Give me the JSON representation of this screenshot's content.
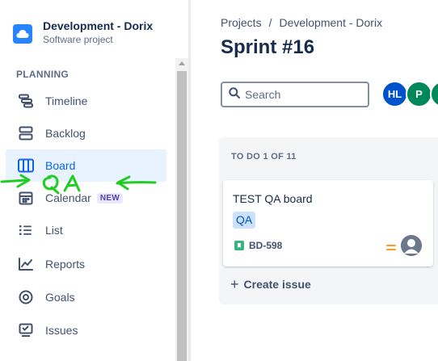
{
  "project": {
    "name": "Development - Dorix",
    "type": "Software project"
  },
  "sidebar": {
    "section_label": "PLANNING",
    "items": [
      {
        "label": "Timeline",
        "icon": "timeline-icon"
      },
      {
        "label": "Backlog",
        "icon": "backlog-icon"
      },
      {
        "label": "Board",
        "icon": "board-icon",
        "active": true
      },
      {
        "label": "Calendar",
        "icon": "calendar-icon",
        "badge": "NEW"
      },
      {
        "label": "List",
        "icon": "list-icon"
      },
      {
        "label": "Reports",
        "icon": "reports-icon"
      },
      {
        "label": "Goals",
        "icon": "goals-icon"
      },
      {
        "label": "Issues",
        "icon": "issues-icon"
      }
    ]
  },
  "annotation": {
    "text": "QA",
    "color": "#22cc22"
  },
  "breadcrumb": {
    "items": [
      "Projects",
      "Development - Dorix"
    ],
    "separator": "/"
  },
  "page": {
    "title": "Sprint #16"
  },
  "search": {
    "placeholder": "Search"
  },
  "avatars": [
    {
      "initials": "HL",
      "color": "#0052cc"
    },
    {
      "initials": "P",
      "color": "#00875a"
    },
    {
      "initials": "",
      "color": "#00875a"
    }
  ],
  "board": {
    "column": {
      "header": "TO DO 1 OF 11",
      "cards": [
        {
          "title": "TEST QA board",
          "label": "QA",
          "key": "BD-598",
          "priority_color": "#ff991f"
        }
      ],
      "create_label": "Create issue"
    }
  },
  "colors": {
    "accent": "#0c66e4",
    "active_bg": "#e9f2ff",
    "story": "#36b37e"
  }
}
